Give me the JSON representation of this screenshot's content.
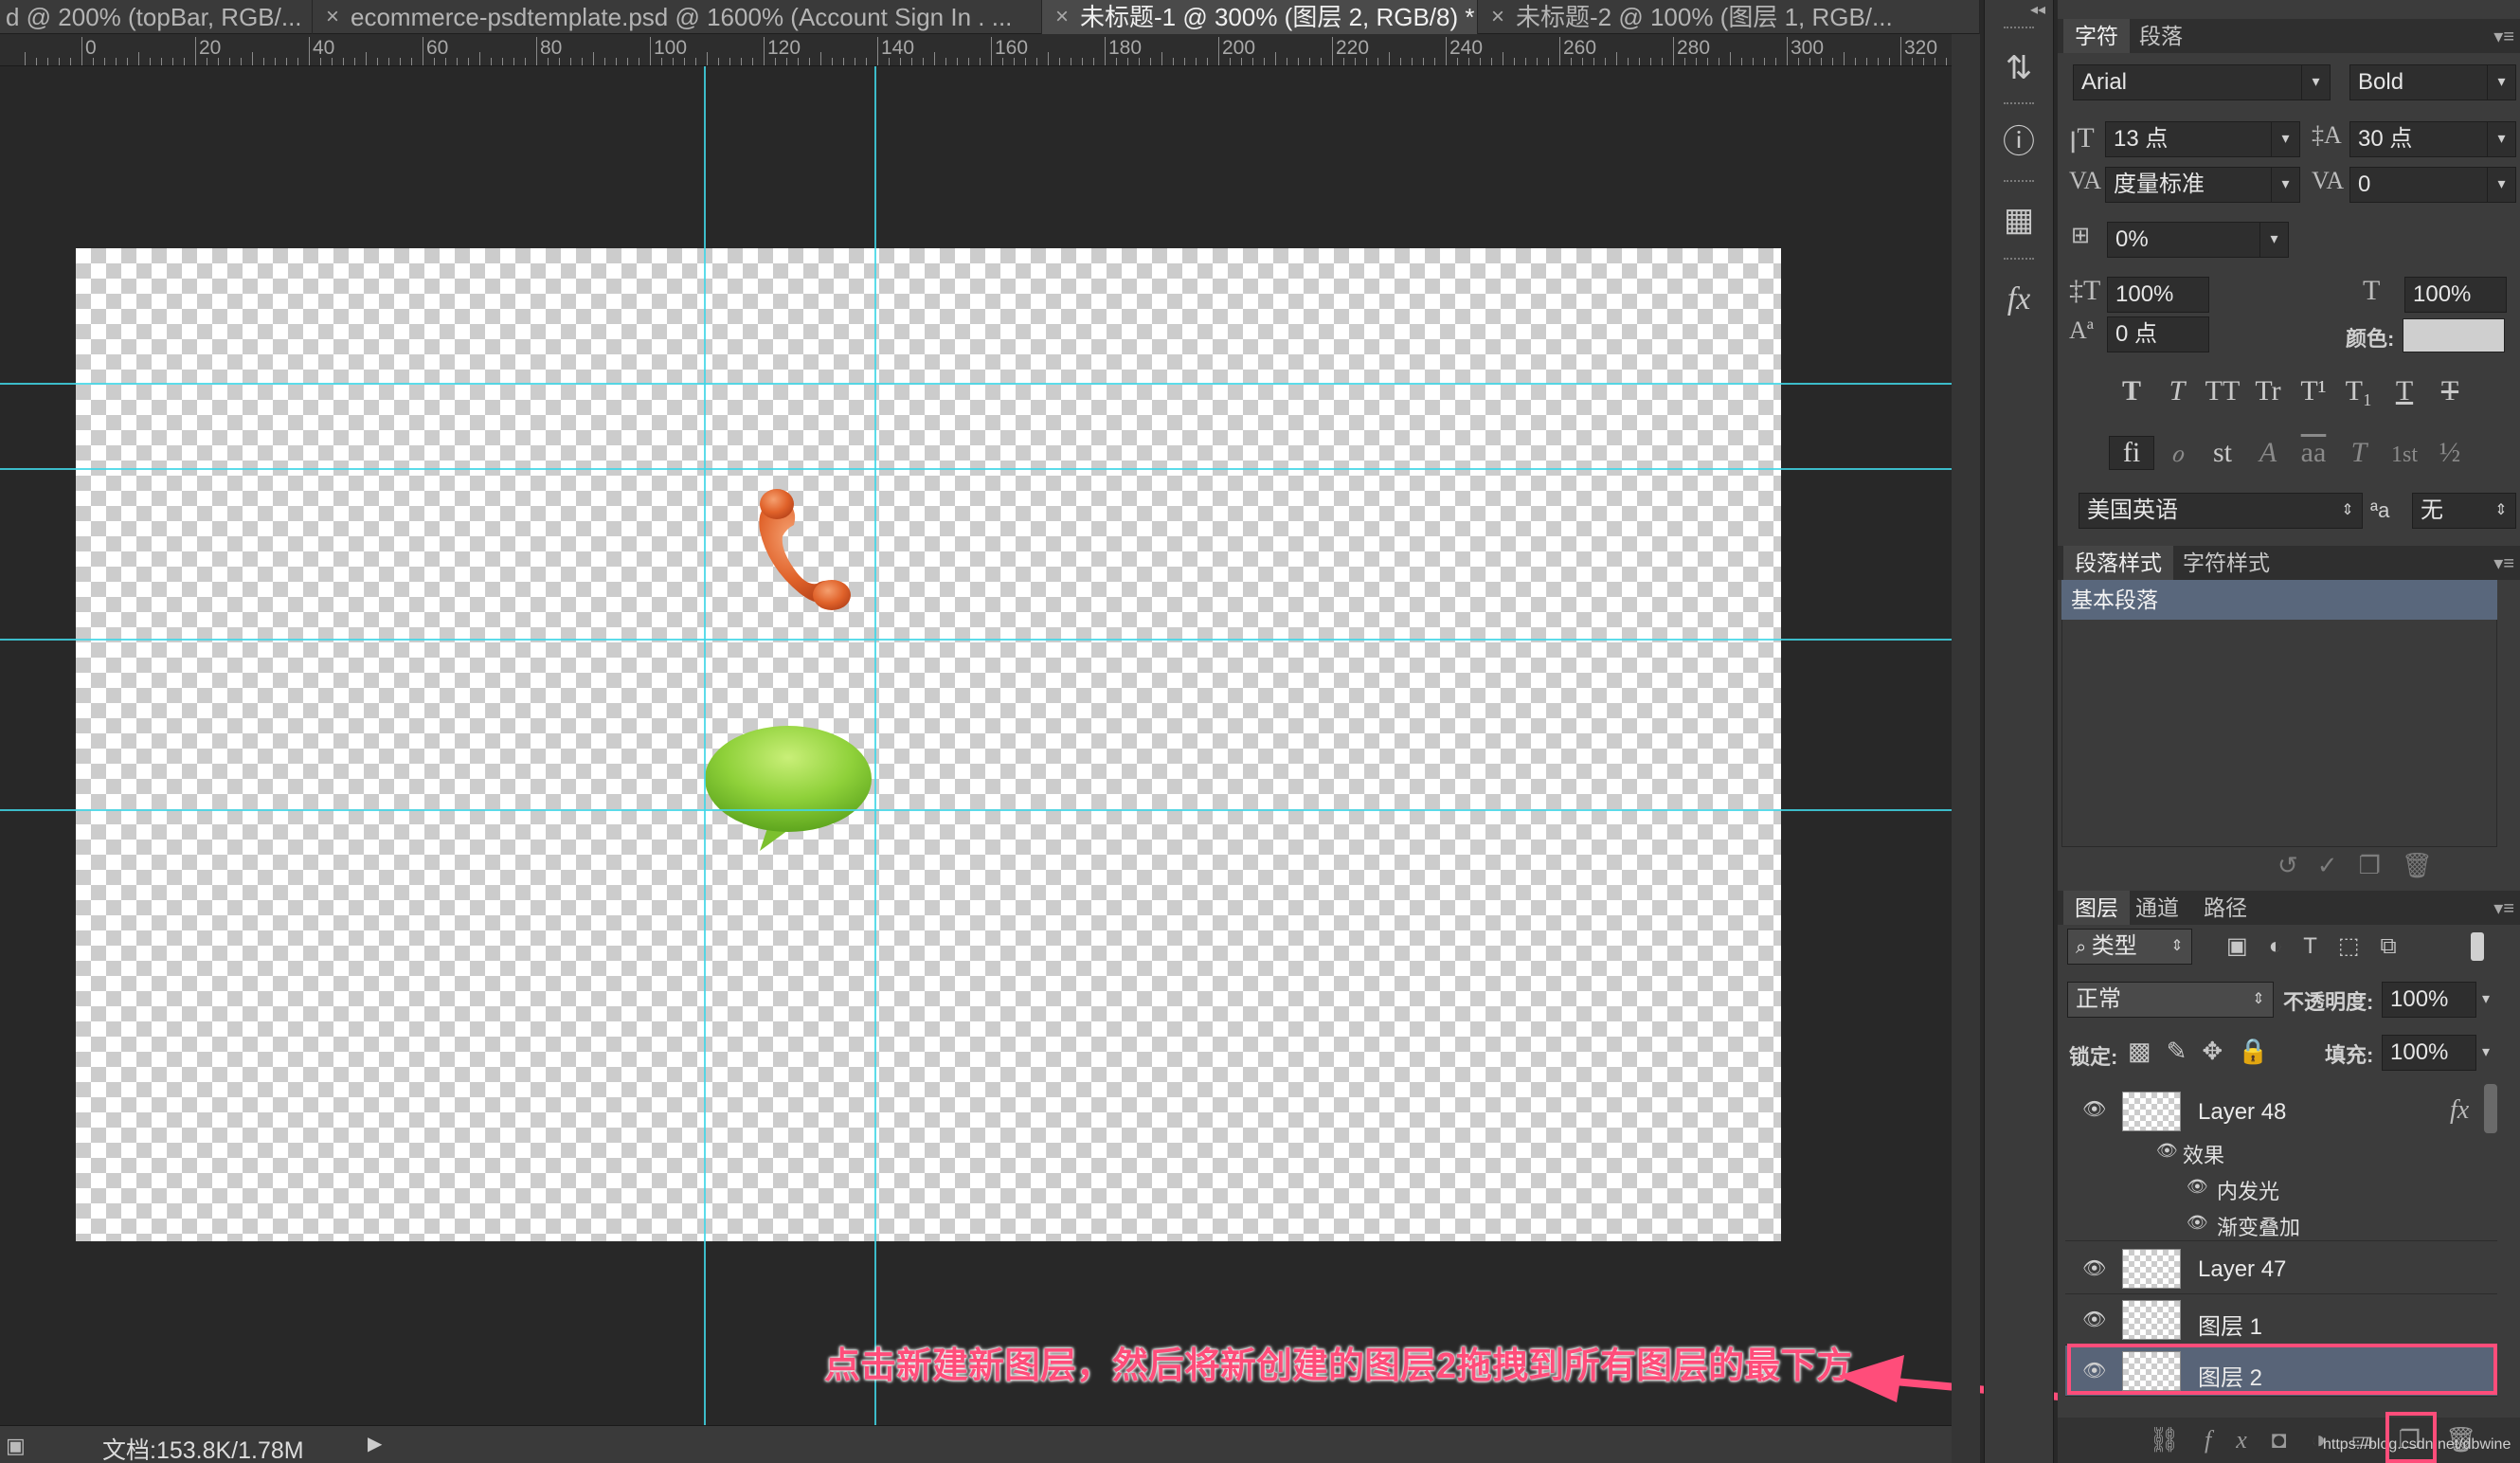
{
  "tabs": [
    {
      "label": "d @ 200% (topBar, RGB/...",
      "close": ""
    },
    {
      "label": "ecommerce-psdtemplate.psd @ 1600% (Account Sign In  . ...",
      "close": "×"
    },
    {
      "label": "未标题-1 @ 300% (图层 2, RGB/8) *",
      "close": "×"
    },
    {
      "label": "未标题-2 @ 100% (图层 1, RGB/...",
      "close": "×"
    }
  ],
  "ruler": {
    "labels": [
      "0",
      "20",
      "40",
      "60",
      "80",
      "100",
      "120",
      "140",
      "160",
      "180",
      "200",
      "220",
      "240",
      "260",
      "280",
      "300",
      "320"
    ]
  },
  "status": {
    "doc_label": "文档:153.8K/1.78M",
    "arrow": "▶"
  },
  "annotation": {
    "text": "点击新建新图层，然后将新创建的图层2拖拽到所有图层的最下方"
  },
  "watermark": "https://blog.csdn.net/dbwine",
  "character_panel": {
    "tabs": [
      "字符",
      "段落"
    ],
    "font_family": "Arial",
    "font_style": "Bold",
    "font_size": "13 点",
    "leading": "30 点",
    "kerning": "度量标准",
    "tracking": "0",
    "tsume": "0%",
    "vscale": "100%",
    "hscale": "100%",
    "baseline": "0 点",
    "color_label": "颜色:",
    "color": "#cfcfcf",
    "style_glyphs": [
      "T",
      "T",
      "TT",
      "Tr",
      "T¹",
      "T₁",
      "T",
      "T"
    ],
    "opentype_glyphs": [
      "fi",
      "ℴ",
      "st",
      "A",
      "aa",
      "T",
      "1st",
      "½"
    ],
    "language": "美国英语",
    "aa_label": "ªa",
    "antialias": "无"
  },
  "paragraph_styles": {
    "tabs": [
      "段落样式",
      "字符样式"
    ],
    "items": [
      "基本段落"
    ]
  },
  "layers_panel": {
    "tabs": [
      "图层",
      "通道",
      "路径"
    ],
    "filter_label": "类型",
    "blend_mode": "正常",
    "opacity_label": "不透明度:",
    "opacity": "100%",
    "lock_label": "锁定:",
    "fill_label": "填充:",
    "fill": "100%",
    "layers": [
      {
        "name": "Layer 48",
        "fx": "fx",
        "effects_label": "效果",
        "effects": [
          "内发光",
          "渐变叠加"
        ]
      },
      {
        "name": "Layer 47"
      },
      {
        "name": "图层 1"
      },
      {
        "name": "图层 2",
        "selected": true
      }
    ]
  },
  "colors": {
    "guide": "#3fd6e6",
    "annotation": "#ff4d7a",
    "selection": "#586478"
  }
}
